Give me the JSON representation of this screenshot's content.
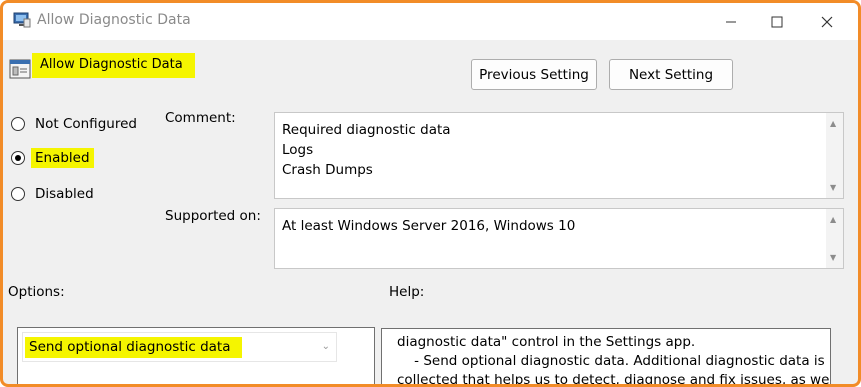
{
  "window": {
    "title": "Allow Diagnostic Data"
  },
  "policy": {
    "name": "Allow Diagnostic Data"
  },
  "nav": {
    "previous": "Previous Setting",
    "next": "Next Setting"
  },
  "state": {
    "options": [
      {
        "label": "Not Configured",
        "selected": false
      },
      {
        "label": "Enabled",
        "selected": true
      },
      {
        "label": "Disabled",
        "selected": false
      }
    ]
  },
  "comment": {
    "label": "Comment:",
    "lines": [
      "Required diagnostic data",
      "Logs",
      "Crash Dumps"
    ]
  },
  "supported": {
    "label": "Supported on:",
    "value": "At least Windows Server 2016, Windows 10"
  },
  "options_section": {
    "label": "Options:",
    "dropdown_value": "Send optional diagnostic data"
  },
  "help": {
    "label": "Help:",
    "lines": [
      "diagnostic data\" control in the Settings app.",
      "    - Send optional diagnostic data. Additional diagnostic data is",
      "collected that helps us to detect, diagnose and fix issues, as well as"
    ]
  },
  "colors": {
    "highlight": "#f5f500",
    "frame_accent": "#f28c28"
  }
}
